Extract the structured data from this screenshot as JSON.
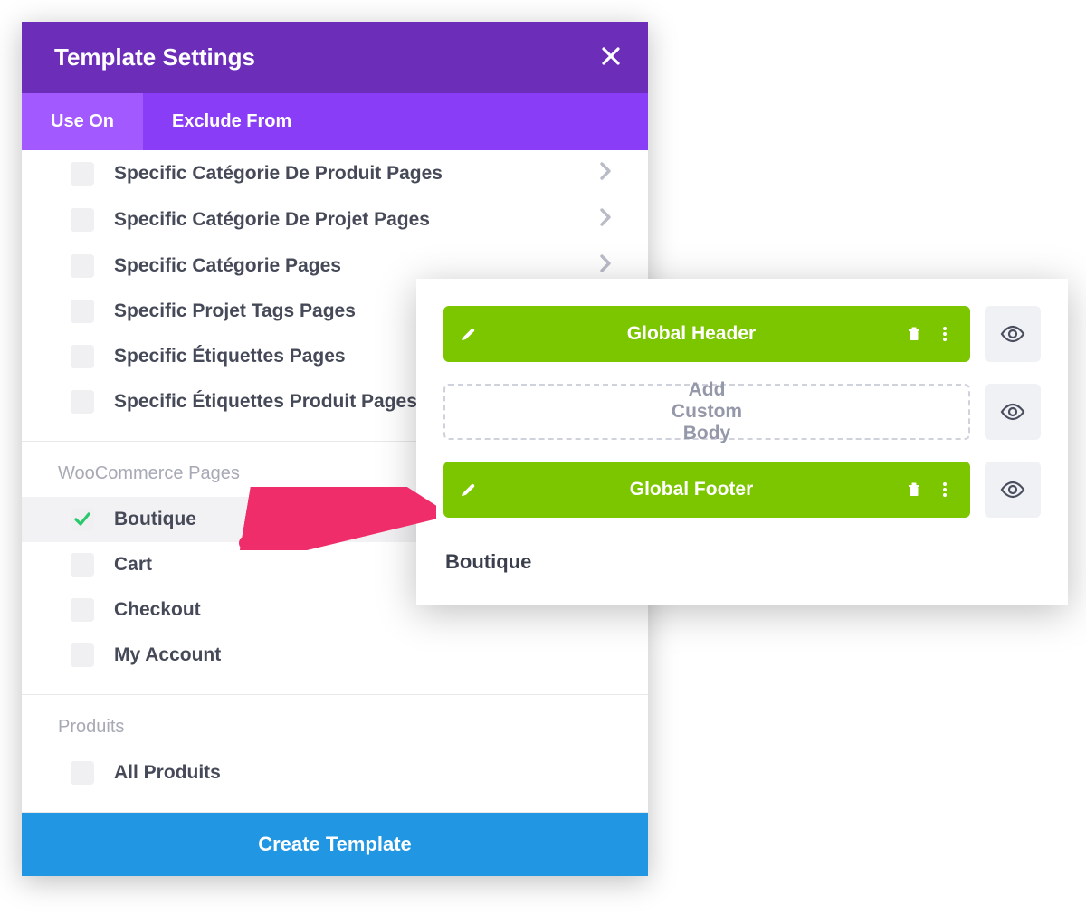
{
  "modal": {
    "title": "Template Settings",
    "tabs": {
      "use_on": "Use On",
      "exclude_from": "Exclude From"
    },
    "specific_items": [
      {
        "label": "Specific Catégorie De Produit Pages",
        "chevron": true
      },
      {
        "label": "Specific Catégorie De Projet Pages",
        "chevron": true
      },
      {
        "label": "Specific Catégorie Pages",
        "chevron": true
      },
      {
        "label": "Specific Projet Tags Pages",
        "chevron": false
      },
      {
        "label": "Specific Étiquettes Pages",
        "chevron": false
      },
      {
        "label": "Specific Étiquettes Produit Pages",
        "chevron": false
      }
    ],
    "woocommerce": {
      "header": "WooCommerce Pages",
      "items": [
        {
          "label": "Boutique",
          "checked": true
        },
        {
          "label": "Cart",
          "checked": false
        },
        {
          "label": "Checkout",
          "checked": false
        },
        {
          "label": "My Account",
          "checked": false
        }
      ]
    },
    "produits": {
      "header": "Produits",
      "items": [
        {
          "label": "All Produits",
          "checked": false
        }
      ]
    },
    "footer_button": "Create Template"
  },
  "panel": {
    "rows": [
      {
        "type": "solid",
        "label": "Global Header"
      },
      {
        "type": "dashed",
        "label": "Add Custom Body"
      },
      {
        "type": "solid",
        "label": "Global Footer"
      }
    ],
    "caption": "Boutique"
  },
  "colors": {
    "purple_dark": "#6c2eb9",
    "purple_mid": "#8a3df7",
    "purple_light": "#a259ff",
    "green": "#7cc600",
    "blue": "#2196e3",
    "pink": "#ef2d6a"
  }
}
